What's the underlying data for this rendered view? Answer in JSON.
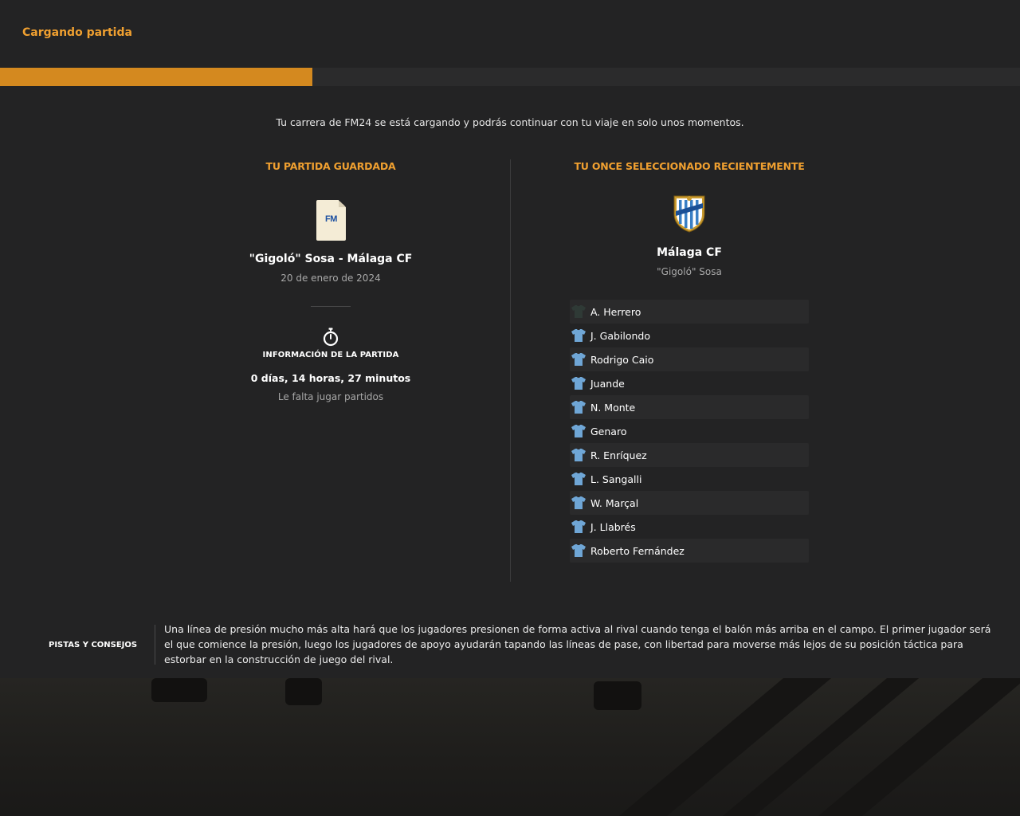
{
  "header": {
    "title": "Cargando partida"
  },
  "progress": {
    "percent": 30.6
  },
  "intro": "Tu carrera de FM24 se está cargando y podrás continuar con tu viaje en solo unos momentos.",
  "saved_game": {
    "section_title": "TU PARTIDA GUARDADA",
    "icon_text": "FM",
    "name": "\"Gigoló\" Sosa - Málaga CF",
    "date": "20 de enero de 2024",
    "info_title": "INFORMACIÓN DE LA PARTIDA",
    "play_time": "0 días, 14 horas, 27 minutos",
    "status": "Le falta jugar partidos"
  },
  "lineup": {
    "section_title": "TU ONCE SELECCIONADO RECIENTEMENTE",
    "team": "Málaga CF",
    "manager": "\"Gigoló\" Sosa",
    "colors": {
      "outfield_shirt": "#6fa6d6",
      "keeper_shirt": "#2f3a36"
    },
    "players": [
      {
        "name": "A. Herrero",
        "keeper": true
      },
      {
        "name": "J. Gabilondo",
        "keeper": false
      },
      {
        "name": "Rodrigo Caio",
        "keeper": false
      },
      {
        "name": "Juande",
        "keeper": false
      },
      {
        "name": "N. Monte",
        "keeper": false
      },
      {
        "name": "Genaro",
        "keeper": false
      },
      {
        "name": "R. Enríquez",
        "keeper": false
      },
      {
        "name": "L. Sangalli",
        "keeper": false
      },
      {
        "name": "W. Marçal",
        "keeper": false
      },
      {
        "name": "J. Llabrés",
        "keeper": false
      },
      {
        "name": "Roberto Fernández",
        "keeper": false
      }
    ]
  },
  "tips": {
    "label": "PISTAS Y CONSEJOS",
    "text": "Una línea de presión mucho más alta hará que los jugadores presionen de forma activa al rival cuando tenga el balón más arriba en el campo. El primer jugador será el que comience la presión, luego los jugadores de apoyo ayudarán tapando las líneas de pase, con libertad para moverse más lejos de su posición táctica para estorbar en la construcción de juego del rival."
  },
  "accent_color": "#f0a030",
  "progress_color": "#d4891f"
}
